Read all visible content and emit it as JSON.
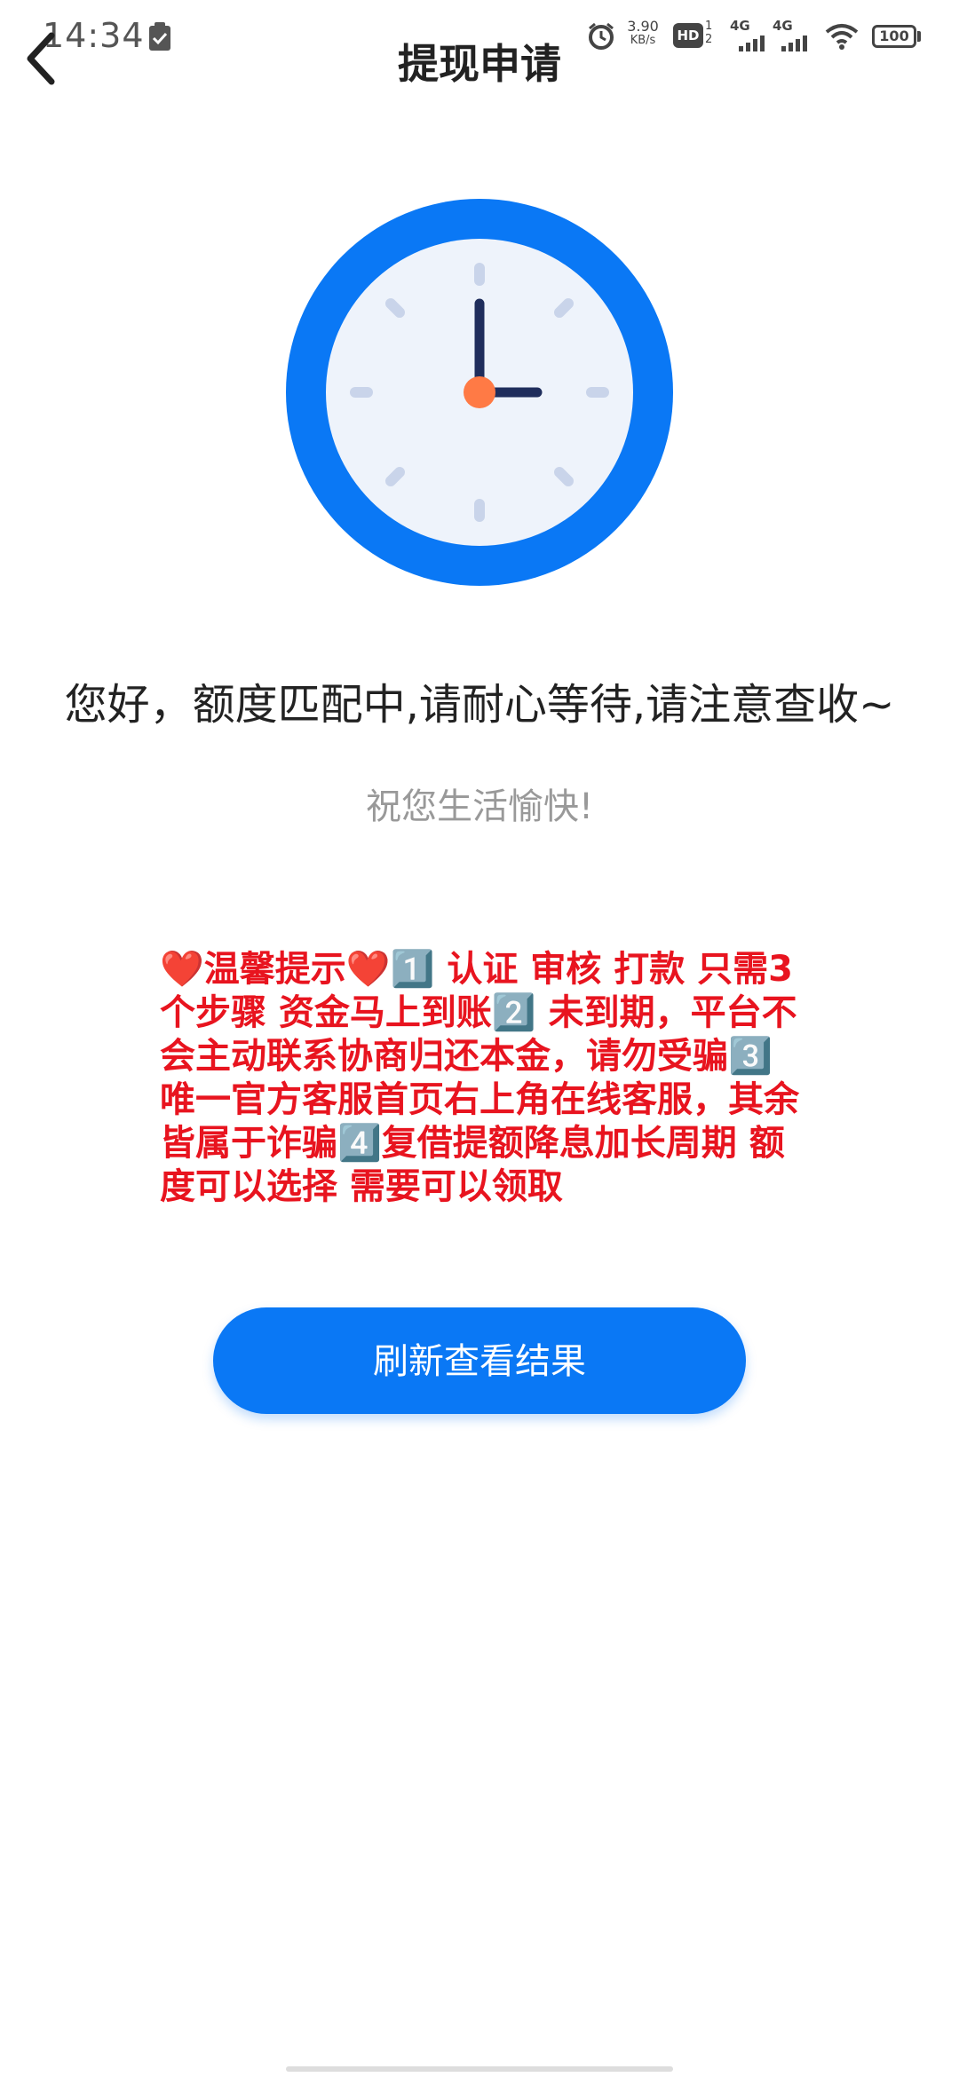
{
  "status_bar": {
    "time": "14:34",
    "net_speed_value": "3.90",
    "net_speed_unit": "KB/s",
    "battery": "100",
    "network_1": "4G",
    "network_2": "4G",
    "hd_label": "HD",
    "sim_label": "1 2"
  },
  "nav": {
    "title": "提现申请"
  },
  "content": {
    "main_message": "您好，额度匹配中,请耐心等待,请注意查收~",
    "sub_message": "祝您生活愉快!",
    "notice": "❤️温馨提示❤️1️⃣ 认证 审核 打款 只需3个步骤  资金马上到账2️⃣ 未到期，平台不会主动联系协商归还本金，请勿受骗3️⃣ 唯一官方客服首页右上角在线客服，其余皆属于诈骗4️⃣复借提额降息加长周期 额度可以选择 需要可以领取"
  },
  "actions": {
    "refresh_label": "刷新查看结果"
  },
  "colors": {
    "accent": "#0a78f5",
    "notice": "#e8141f",
    "clock_face": "#eef3fb",
    "clock_hands": "#1f2d5c",
    "clock_center": "#ff7a45"
  }
}
